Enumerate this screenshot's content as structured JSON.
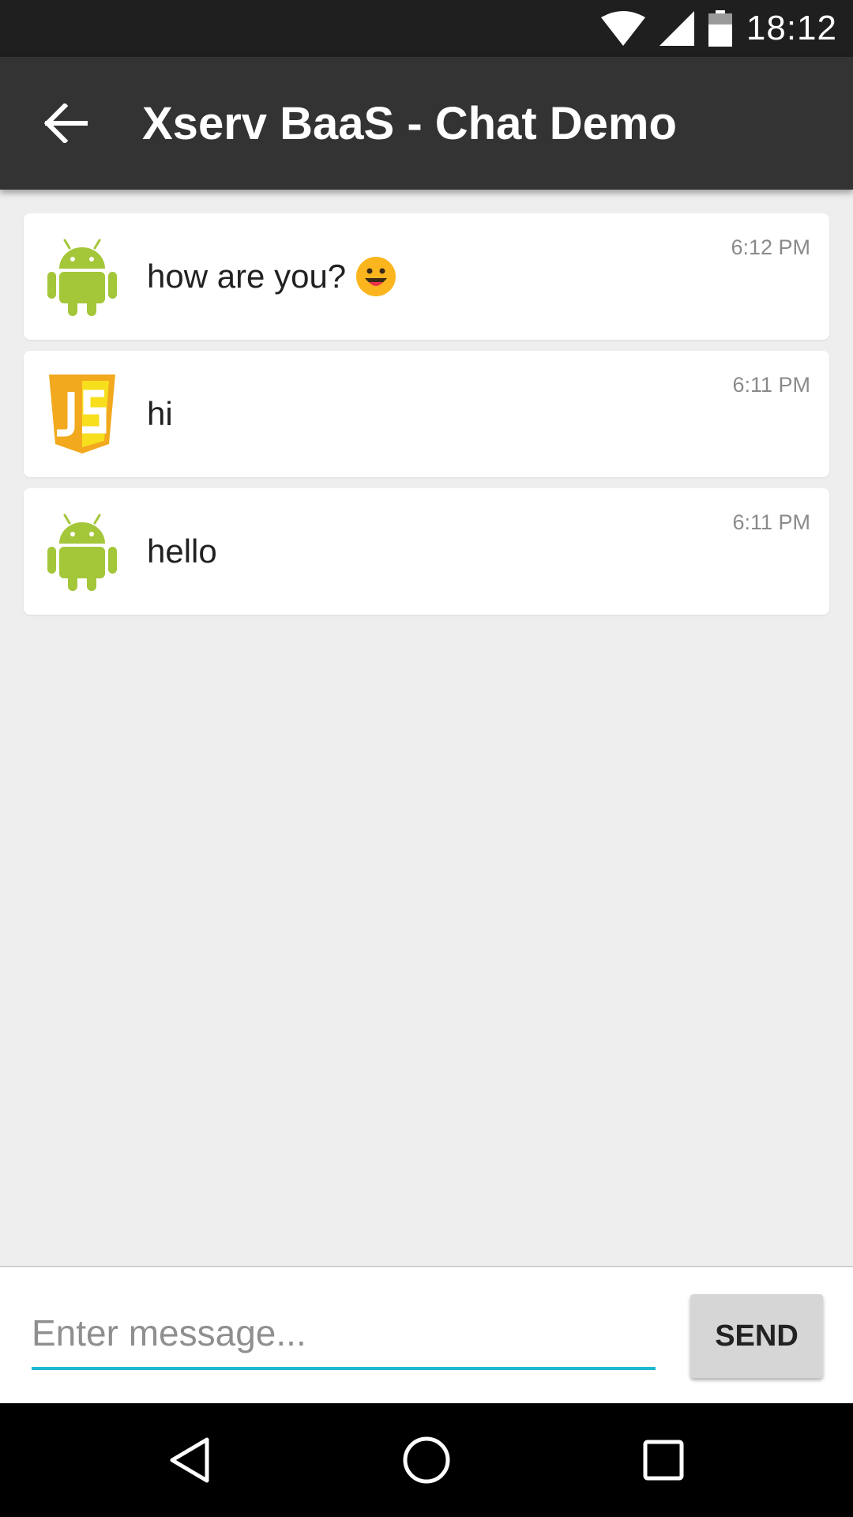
{
  "status_bar": {
    "time": "18:12",
    "icons": [
      "wifi-icon",
      "signal-icon",
      "battery-icon"
    ]
  },
  "app_bar": {
    "title": "Xserv BaaS - Chat Demo",
    "back_icon": "arrow-back-icon"
  },
  "messages": [
    {
      "avatar": "android-icon",
      "text": "how are you?",
      "emoji": "smiling-face-emoji",
      "time": "6:12 PM"
    },
    {
      "avatar": "javascript-icon",
      "text": "hi",
      "time": "6:11 PM"
    },
    {
      "avatar": "android-icon",
      "text": "hello",
      "time": "6:11 PM"
    }
  ],
  "composer": {
    "placeholder": "Enter message...",
    "value": "",
    "send_label": "SEND",
    "accent_color": "#1eb8d0"
  },
  "nav_bar": {
    "icons": [
      "back-triangle-icon",
      "home-circle-icon",
      "recents-square-icon"
    ]
  },
  "colors": {
    "status_bar": "#1f1f1f",
    "app_bar": "#333333",
    "background": "#eeeeee",
    "android_green": "#a4c639",
    "js_yellow": "#f7df1e"
  }
}
